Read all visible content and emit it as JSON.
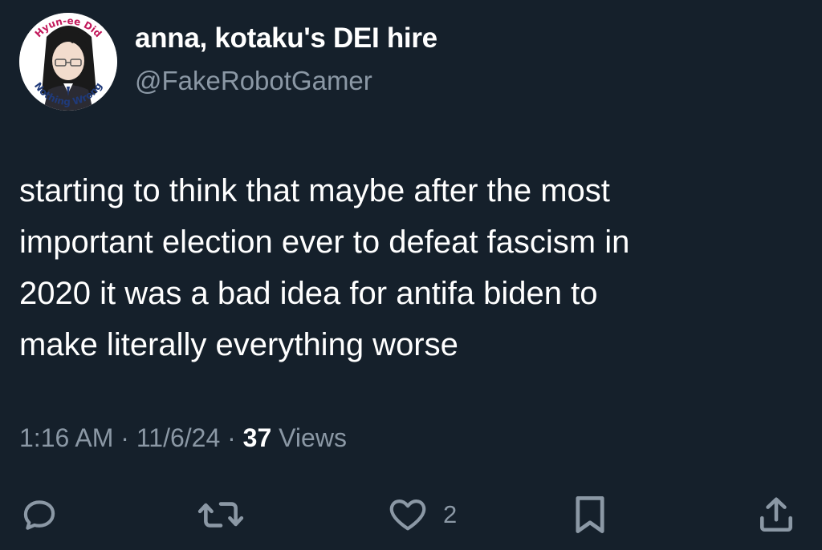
{
  "author": {
    "display_name": "anna, kotaku's DEI hire",
    "handle": "@FakeRobotGamer",
    "avatar_ring_text_top": "Hyun-ee Did",
    "avatar_ring_text_bottom": "Nothing Wrong"
  },
  "tweet": {
    "text": "starting to think that maybe after the most\nimportant election ever to defeat fascism in\n2020 it was a bad idea for antifa biden to\nmake literally everything worse"
  },
  "meta": {
    "time": "1:16 AM",
    "sep1": "·",
    "date": "11/6/24",
    "sep2": "·",
    "views_count": "37",
    "views_label": "Views"
  },
  "actions": {
    "reply_icon": "reply-icon",
    "retweet_icon": "retweet-icon",
    "like_icon": "heart-icon",
    "like_count": "2",
    "bookmark_icon": "bookmark-icon",
    "share_icon": "share-icon"
  },
  "colors": {
    "background": "#15202b",
    "text_primary": "#ffffff",
    "text_secondary": "#8b98a5",
    "icon": "#8b98a5",
    "avatar_ring_text": "#c2185b"
  }
}
